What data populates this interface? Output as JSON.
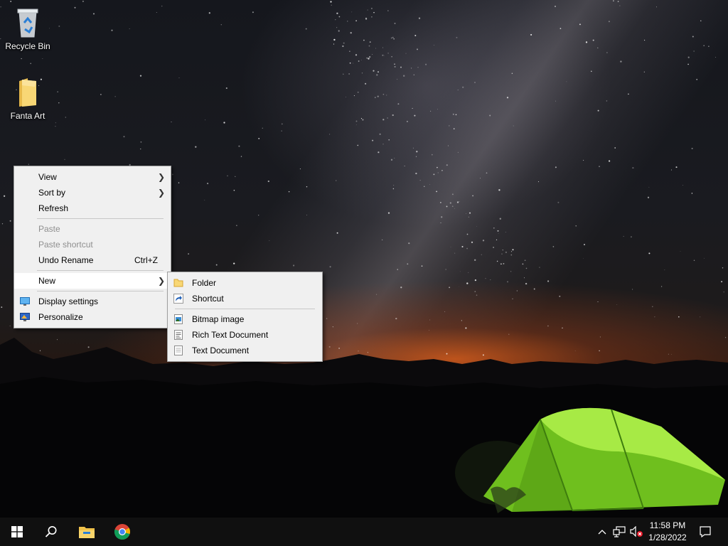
{
  "desktop": {
    "icons": [
      {
        "label": "Recycle Bin",
        "icon": "recycle-bin-icon"
      },
      {
        "label": "Fanta Art",
        "icon": "folder-icon"
      }
    ]
  },
  "context_menu": {
    "items": [
      {
        "label": "View",
        "has_submenu": true
      },
      {
        "label": "Sort by",
        "has_submenu": true
      },
      {
        "label": "Refresh"
      },
      {
        "label": "Paste",
        "disabled": true
      },
      {
        "label": "Paste shortcut",
        "disabled": true
      },
      {
        "label": "Undo Rename",
        "shortcut": "Ctrl+Z"
      },
      {
        "label": "New",
        "has_submenu": true,
        "highlighted": true
      },
      {
        "label": "Display settings",
        "icon": "display-settings-icon"
      },
      {
        "label": "Personalize",
        "icon": "personalize-icon"
      }
    ]
  },
  "new_submenu": {
    "items": [
      {
        "label": "Folder",
        "icon": "folder-icon"
      },
      {
        "label": "Shortcut",
        "icon": "shortcut-icon"
      },
      {
        "label": "Bitmap image",
        "icon": "bitmap-image-icon"
      },
      {
        "label": "Rich Text Document",
        "icon": "rich-text-document-icon"
      },
      {
        "label": "Text Document",
        "icon": "text-document-icon"
      }
    ]
  },
  "taskbar": {
    "buttons": [
      "start-icon",
      "search-icon",
      "file-explorer-icon",
      "chrome-icon"
    ],
    "tray_icons": [
      "chevron-up-icon",
      "network-icon",
      "volume-muted-icon"
    ],
    "clock": {
      "time": "11:58 PM",
      "date": "1/28/2022"
    },
    "notification_icon": "action-center-icon"
  },
  "colors": {
    "menu_bg": "#f0f0f0",
    "taskbar_bg": "#101010",
    "tent_green": "#7ed321"
  }
}
